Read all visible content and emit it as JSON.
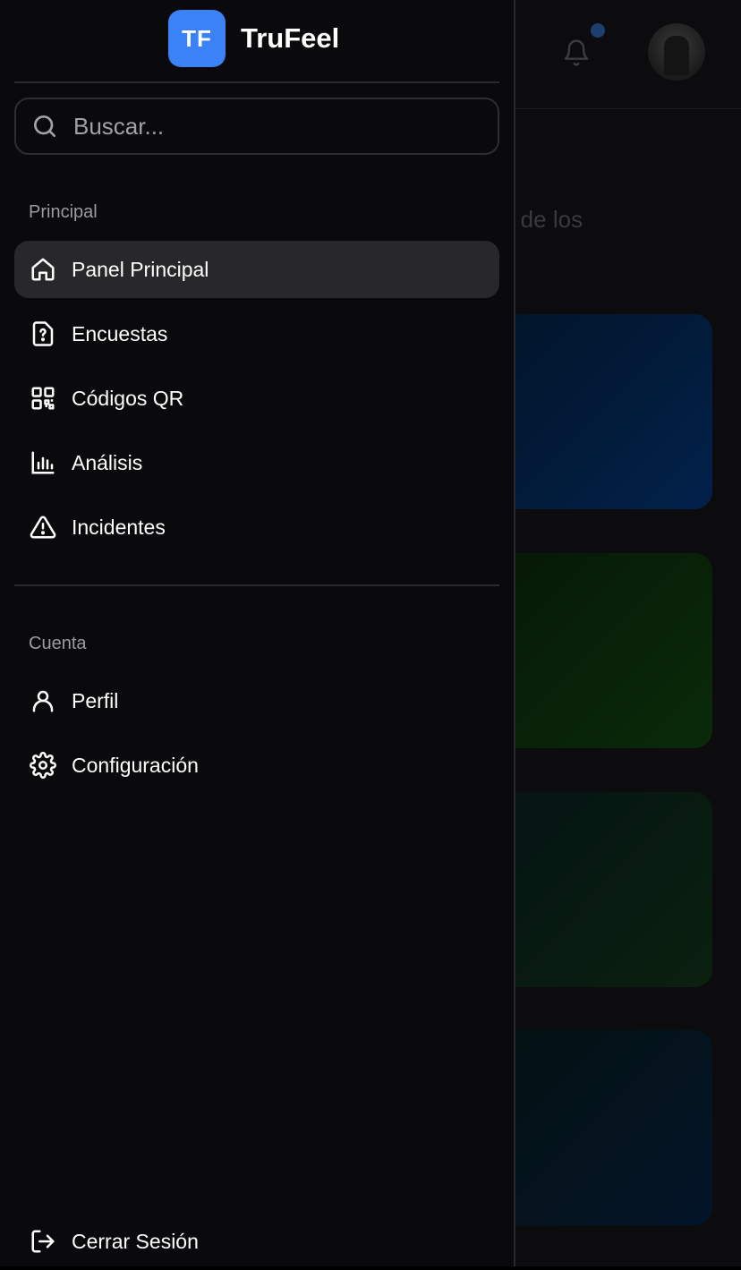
{
  "app": {
    "logo_initials": "TF",
    "name": "TruFeel",
    "accent": "#3b82f6"
  },
  "search": {
    "placeholder": "Buscar..."
  },
  "sections": {
    "principal": "Principal",
    "cuenta": "Cuenta"
  },
  "nav": {
    "principal": [
      {
        "label": "Panel Principal",
        "icon": "home-icon",
        "active": true
      },
      {
        "label": "Encuestas",
        "icon": "question-file-icon"
      },
      {
        "label": "Códigos QR",
        "icon": "qr-code-icon"
      },
      {
        "label": "Análisis",
        "icon": "bar-chart-icon"
      },
      {
        "label": "Incidentes",
        "icon": "warning-icon"
      }
    ],
    "cuenta": [
      {
        "label": "Perfil",
        "icon": "user-icon"
      },
      {
        "label": "Configuración",
        "icon": "gear-icon"
      }
    ],
    "logout": {
      "label": "Cerrar Sesión",
      "icon": "logout-icon"
    }
  },
  "background": {
    "subtitle_fragment": "n de los"
  }
}
